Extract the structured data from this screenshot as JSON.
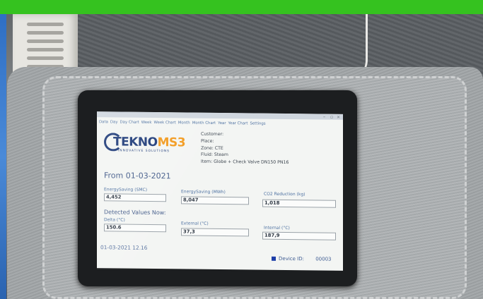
{
  "app": {
    "window_title": "",
    "menu": [
      "Data",
      "Day",
      "Day Chart",
      "Week",
      "Week Chart",
      "Month",
      "Month Chart",
      "Year",
      "Year Chart",
      "Settings"
    ]
  },
  "brand": {
    "logo_main": "TEKNO",
    "logo_accent": "MS3",
    "logo_tagline": "INNOVATIVE SOLUTIONS"
  },
  "info": {
    "customer": "Customer:",
    "place": "Place:",
    "zone": "Zone: CTE",
    "fluid": "Fluid: Steam",
    "item": "Item: Globe + Check Valve DN150 PN16"
  },
  "summary": {
    "from": "From 01-03-2021",
    "energy_smc_label": "EnergySaving (SMC)",
    "energy_smc_value": "4,452",
    "energy_mwh_label": "EnergySaving (MWh)",
    "energy_mwh_value": "8,047",
    "co2_label": "CO2 Reduction (kg)",
    "co2_value": "1,018"
  },
  "detected": {
    "heading": "Detected Values Now:",
    "delta_label": "Delta (°C)",
    "delta_value": "150.6",
    "external_label": "External (°C)",
    "external_value": "37,3",
    "internal_label": "Internal (°C)",
    "internal_value": "187,9"
  },
  "footer": {
    "datetime": "01-03-2021 12.16",
    "device_label": "Device ID:",
    "device_value": "00003"
  },
  "colors": {
    "banner": "#35c21f",
    "brand_blue": "#1d3a78",
    "brand_orange": "#f29a1d"
  }
}
